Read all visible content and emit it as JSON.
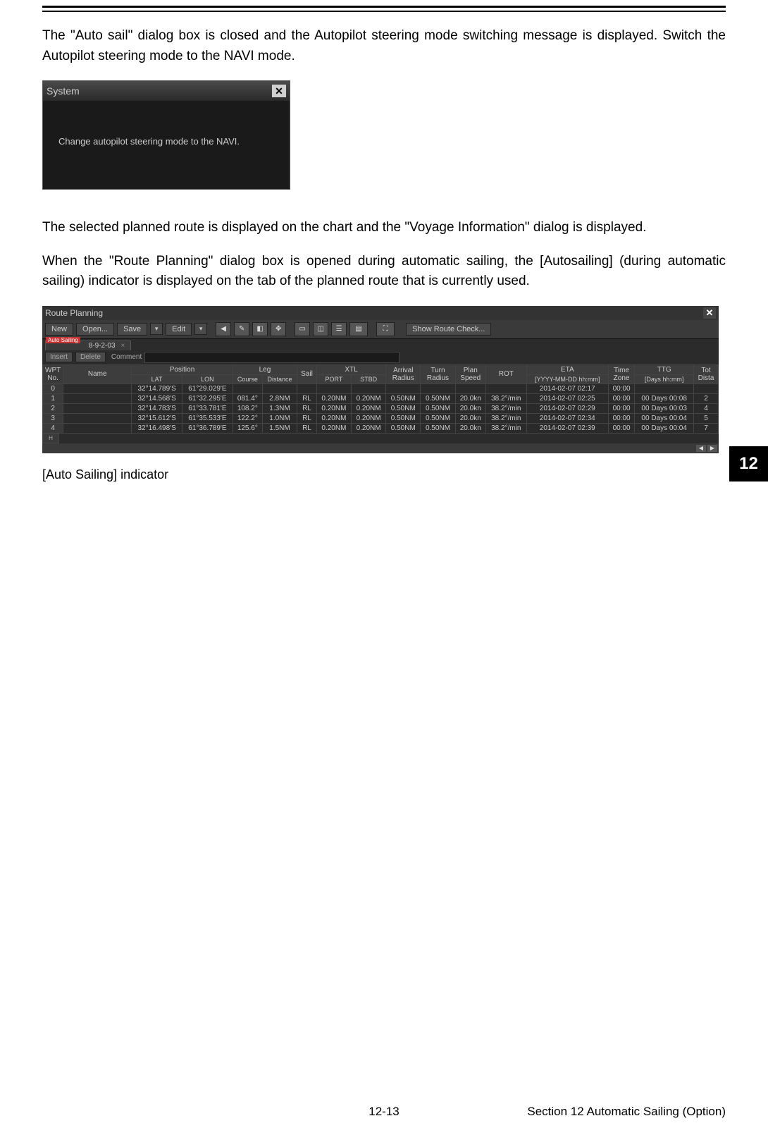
{
  "para1": "The \"Auto sail\" dialog box is closed and the Autopilot steering mode switching message is displayed. Switch the Autopilot steering mode to the NAVI mode.",
  "system_dialog": {
    "title": "System",
    "message": "Change autopilot steering mode to the NAVI."
  },
  "para2": "The selected planned route is displayed on the chart and the \"Voyage Information\" dialog is displayed.",
  "para3": "When the \"Route Planning\" dialog box is opened during automatic sailing, the [Autosailing] (during automatic sailing) indicator is displayed on the tab of the planned route that is currently used.",
  "route_window": {
    "title": "Route Planning",
    "toolbar": {
      "new": "New",
      "open": "Open...",
      "save": "Save",
      "edit": "Edit",
      "show_check": "Show Route Check..."
    },
    "tab": {
      "indicator_text": "Auto Sailing",
      "tab_name": "8-9-2-03"
    },
    "actions": {
      "insert": "Insert",
      "delete": "Delete",
      "comment_label": "Comment"
    },
    "headers": {
      "wpt": "WPT\nNo.",
      "name": "Name",
      "position": "Position",
      "lat": "LAT",
      "lon": "LON",
      "leg": "Leg",
      "course": "Course",
      "distance": "Distance",
      "sail": "Sail",
      "xtl": "XTL",
      "port": "PORT",
      "stbd": "STBD",
      "arrival_radius": "Arrival\nRadius",
      "turn_radius": "Turn\nRadius",
      "plan_speed": "Plan\nSpeed",
      "rot": "ROT",
      "eta": "ETA",
      "eta_fmt": "[YYYY-MM-DD hh:mm]",
      "time_zone": "Time\nZone",
      "ttg": "TTG",
      "ttg_fmt": "[Days hh:mm]",
      "total": "Tot\nDista"
    },
    "rows": [
      {
        "no": "0",
        "lat": "32°14.789'S",
        "lon": "61°29.029'E",
        "course": "",
        "dist": "",
        "sail": "",
        "port": "",
        "stbd": "",
        "ar": "",
        "tr": "",
        "ps": "",
        "rot": "",
        "eta": "2014-02-07 02:17",
        "tz": "00:00",
        "ttg": "",
        "td": ""
      },
      {
        "no": "1",
        "lat": "32°14.568'S",
        "lon": "61°32.295'E",
        "course": "081.4°",
        "dist": "2.8NM",
        "sail": "RL",
        "port": "0.20NM",
        "stbd": "0.20NM",
        "ar": "0.50NM",
        "tr": "0.50NM",
        "ps": "20.0kn",
        "rot": "38.2°/min",
        "eta": "2014-02-07 02:25",
        "tz": "00:00",
        "ttg": "00 Days 00:08",
        "td": "2"
      },
      {
        "no": "2",
        "lat": "32°14.783'S",
        "lon": "61°33.781'E",
        "course": "108.2°",
        "dist": "1.3NM",
        "sail": "RL",
        "port": "0.20NM",
        "stbd": "0.20NM",
        "ar": "0.50NM",
        "tr": "0.50NM",
        "ps": "20.0kn",
        "rot": "38.2°/min",
        "eta": "2014-02-07 02:29",
        "tz": "00:00",
        "ttg": "00 Days 00:03",
        "td": "4"
      },
      {
        "no": "3",
        "lat": "32°15.612'S",
        "lon": "61°35.533'E",
        "course": "122.2°",
        "dist": "1.0NM",
        "sail": "RL",
        "port": "0.20NM",
        "stbd": "0.20NM",
        "ar": "0.50NM",
        "tr": "0.50NM",
        "ps": "20.0kn",
        "rot": "38.2°/min",
        "eta": "2014-02-07 02:34",
        "tz": "00:00",
        "ttg": "00 Days 00:04",
        "td": "5"
      },
      {
        "no": "4",
        "lat": "32°16.498'S",
        "lon": "61°36.789'E",
        "course": "125.6°",
        "dist": "1.5NM",
        "sail": "RL",
        "port": "0.20NM",
        "stbd": "0.20NM",
        "ar": "0.50NM",
        "tr": "0.50NM",
        "ps": "20.0kn",
        "rot": "38.2°/min",
        "eta": "2014-02-07 02:39",
        "tz": "00:00",
        "ttg": "00 Days 00:04",
        "td": "7"
      }
    ]
  },
  "indicator_caption": "[Auto Sailing] indicator",
  "side_tab": "12",
  "footer": {
    "center": "12-13",
    "right": "Section 12    Automatic Sailing (Option)"
  }
}
